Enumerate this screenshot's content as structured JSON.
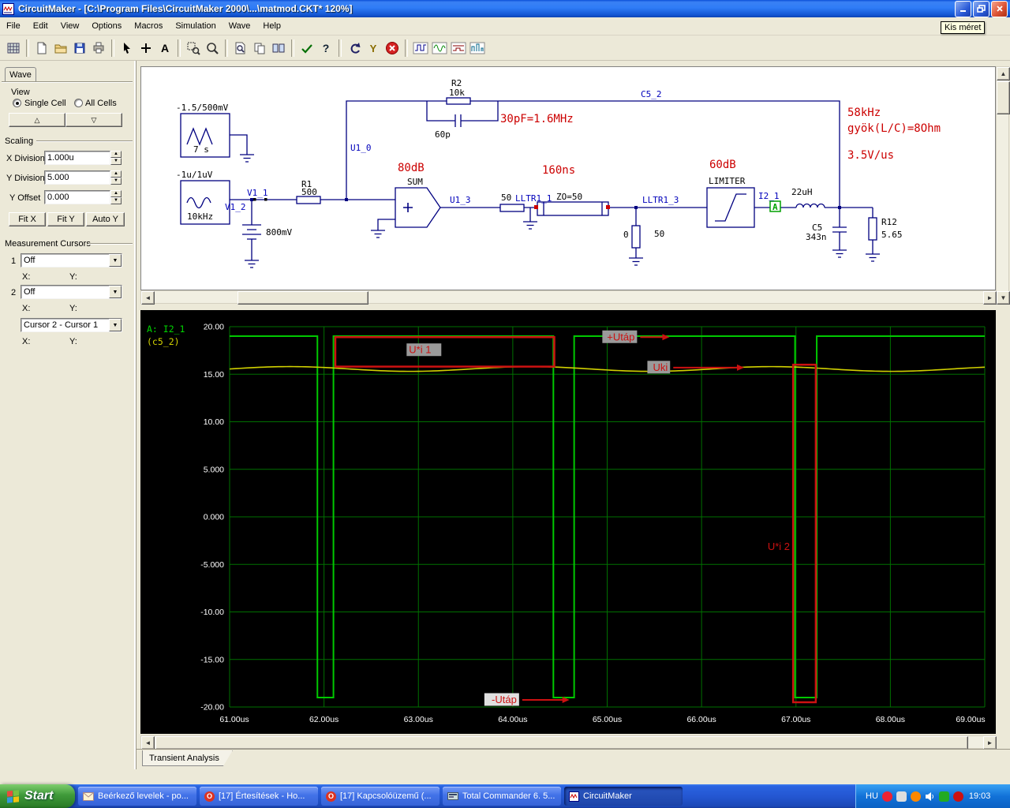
{
  "window": {
    "title": "CircuitMaker - [C:\\Program Files\\CircuitMaker 2000\\...\\matmod.CKT* 120%]",
    "tooltip": "Kis méret"
  },
  "menu": {
    "items": [
      "File",
      "Edit",
      "View",
      "Options",
      "Macros",
      "Simulation",
      "Wave",
      "Help"
    ]
  },
  "toolbar": {
    "icons": [
      "board",
      "new-file",
      "open-folder",
      "save",
      "print",
      "cursor",
      "plus-tool",
      "text-tool",
      "zoom-area",
      "zoom",
      "page-search",
      "copy",
      "split-view",
      "check",
      "help",
      "undo",
      "scope-probe",
      "stop-simulation",
      "waveform-1",
      "waveform-2",
      "waveform-3",
      "waveform-4"
    ]
  },
  "panel": {
    "tab": "Wave",
    "view_label": "View",
    "single_cell": "Single Cell",
    "all_cells": "All Cells",
    "up_triangle": "△",
    "down_triangle": "▽",
    "scaling_label": "Scaling",
    "x_division_label": "X Division",
    "x_division_value": "1.000u",
    "y_division_label": "Y Division",
    "y_division_value": "5.000",
    "y_offset_label": "Y Offset",
    "y_offset_value": "0.000",
    "fit_x": "Fit X",
    "fit_y": "Fit Y",
    "auto_y": "Auto Y",
    "cursors_label": "Measurement Cursors",
    "cursor1_num": "1",
    "cursor1_value": "Off",
    "cursor2_num": "2",
    "cursor2_value": "Off",
    "x_label": "X:",
    "y_label": "Y:",
    "cursor_diff_value": "Cursor 2 - Cursor 1"
  },
  "schematic": {
    "source1_label": "-1.5/500mV",
    "source1_value": "7 s",
    "source2_label": "-1u/1uV",
    "source2_value": "10kHz",
    "net_v1_1": "V1_1",
    "net_v1_2": "V1_2",
    "battery_value": "800mV",
    "r1_name": "R1",
    "r1_value": "500",
    "r2_name": "R2",
    "r2_value": "10k",
    "c2_value": "60p",
    "note_pole": "30pF=1.6MHz",
    "net_u1_0": "U1_0",
    "net_c5_2": "C5_2",
    "note_gain": "80dB",
    "sum_label": "SUM",
    "net_u1_3": "U1_3",
    "r_series_value": "50",
    "net_lltr1_1": "LLTR1_1",
    "note_delay": "160ns",
    "tline_label": "ZO=50",
    "shunt_node": "0",
    "shunt_value": "50",
    "net_lltr1_3": "LLTR1_3",
    "note_limiter_gain": "60dB",
    "limiter_label": "LIMITER",
    "net_probe": "I2_1",
    "probe_letter": "A",
    "l1_value": "22uH",
    "c5_name": "C5",
    "c5_value": "343n",
    "r12_name": "R12",
    "r12_value": "5.65",
    "note_freq": "58kHz",
    "note_impedance": "gyök(L/C)=8Ohm",
    "note_slew": "3.5V/us"
  },
  "chart_data": {
    "type": "line",
    "title": "Transient Analysis",
    "x_unit": "us",
    "xlim": [
      61,
      69
    ],
    "ylim": [
      -20,
      20
    ],
    "x_tick_step": 1,
    "y_tick_step": 5,
    "x_ticks": [
      "61.00us",
      "62.00us",
      "63.00us",
      "64.00us",
      "65.00us",
      "66.00us",
      "67.00us",
      "68.00us",
      "69.00us"
    ],
    "y_ticks": [
      "20.00",
      "15.00",
      "10.00",
      "5.000",
      "0.000",
      "-5.000",
      "-10.00",
      "-15.00",
      "-20.00"
    ],
    "grid": true,
    "grid_color": "#007000",
    "background": "#000000",
    "legend_position": "top-left",
    "legend": [
      {
        "text": "A: I2_1",
        "color": "#00d400"
      },
      {
        "text": "(c5_2)",
        "color": "#d4d400"
      }
    ],
    "series": [
      {
        "name": "I2_1",
        "color": "#00c800",
        "shape": "square",
        "high": 19,
        "low": -19,
        "dips": [
          [
            61.93,
            62.1
          ],
          [
            64.43,
            64.65
          ],
          [
            66.99,
            67.22
          ]
        ]
      },
      {
        "name": "c5_2",
        "color": "#d0d000",
        "shape": "ripple",
        "base": 15.55,
        "amp": 0.25,
        "period": 2.55
      }
    ],
    "annotations": {
      "color": "#cc1111",
      "rects": [
        {
          "label": "U*i 1",
          "x1": 62.12,
          "x2": 64.44,
          "y1": 15.8,
          "y2": 18.9,
          "label_x": 62.9,
          "label_y": 17.2,
          "label_bg": "#9a9a9a"
        },
        {
          "label": "U*i 2",
          "x1": 66.97,
          "x2": 67.21,
          "y1": -19.5,
          "y2": 16.0,
          "label_x": 66.7,
          "label_y": -3.5,
          "label_bg": null
        }
      ],
      "arrows": [
        {
          "label": "+Utáp",
          "x1": 65.35,
          "x2": 65.66,
          "y": 18.9,
          "label_bg": "#9a9a9a"
        },
        {
          "label": "Uki",
          "x1": 65.7,
          "x2": 66.45,
          "y": 15.7,
          "label_bg": "#9a9a9a"
        },
        {
          "label": "-Utáp",
          "x1": 64.1,
          "x2": 64.6,
          "y": -19.25,
          "label_bg": "#e0e0e0"
        }
      ]
    }
  },
  "tabs": {
    "transient": "Transient Analysis"
  },
  "taskbar": {
    "start": "Start",
    "tasks": [
      "Beérkező levelek - po...",
      "[17] Értesítések - Ho...",
      "[17] Kapcsolóüzemű (...",
      "Total Commander 6. 5...",
      "CircuitMaker"
    ],
    "lang": "HU",
    "clock": "19:03"
  }
}
